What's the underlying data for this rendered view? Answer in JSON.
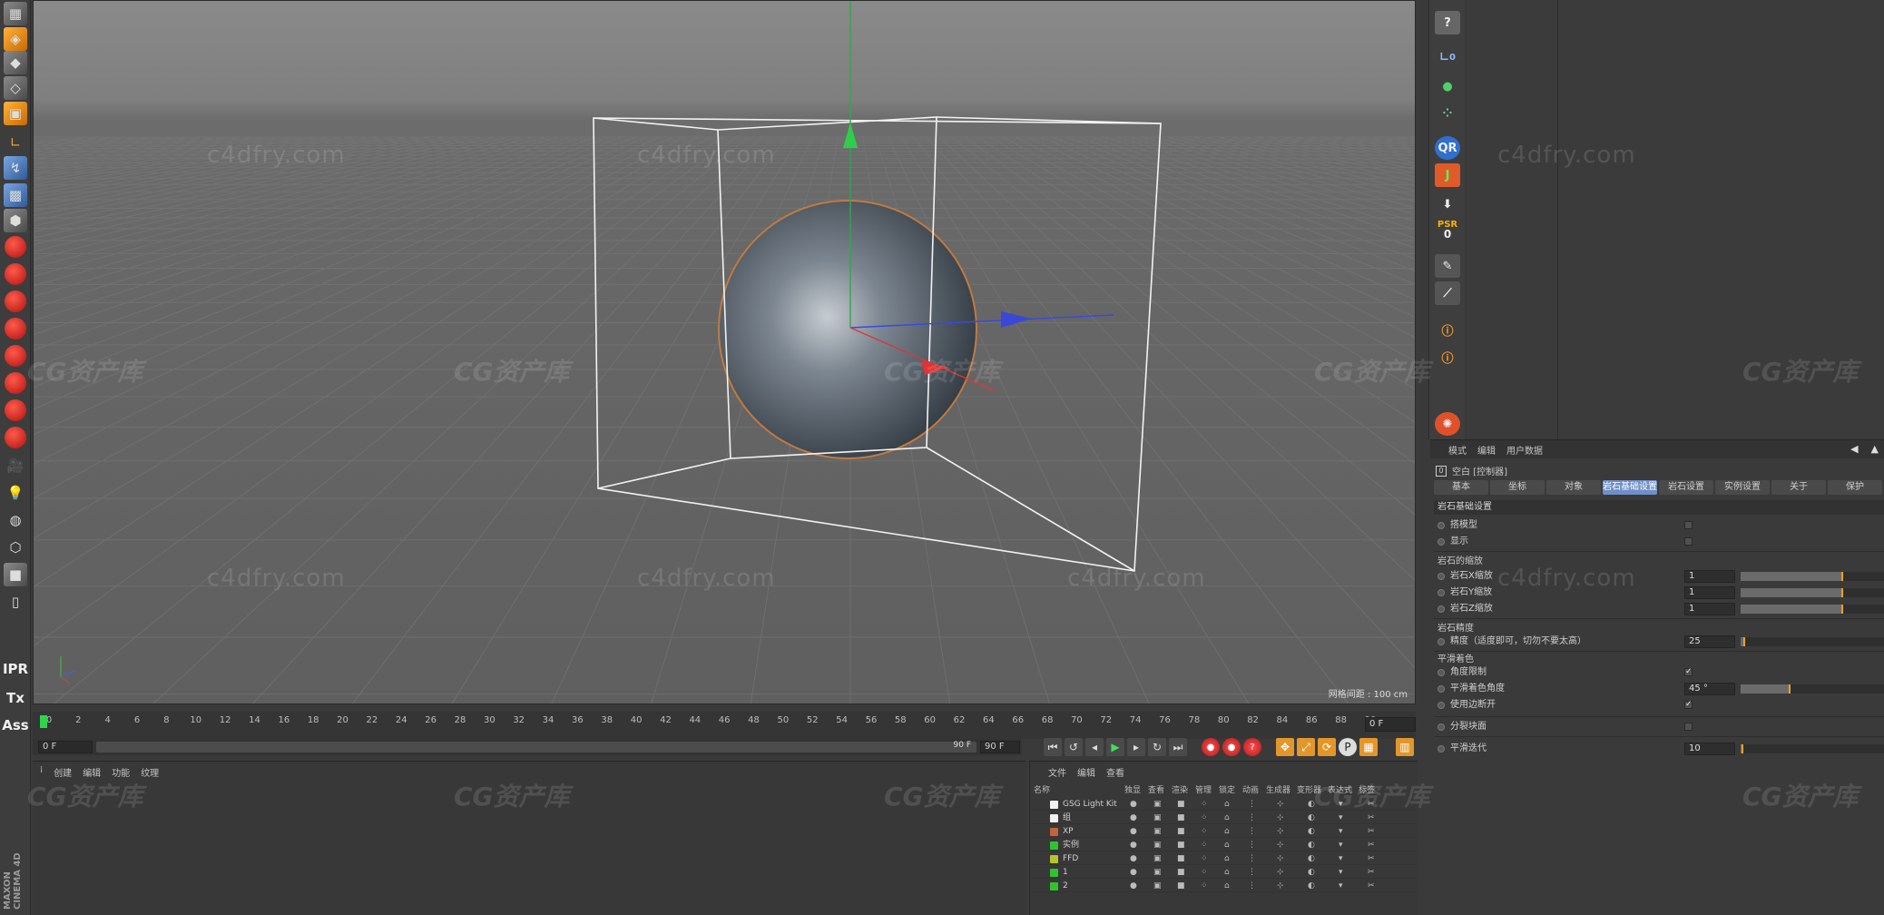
{
  "viewport": {
    "grid_info": "网格间距 : 100 cm"
  },
  "left_tools": [
    "IPR",
    "Tx",
    "Ass"
  ],
  "app_logo": "MAXON CINEMA 4D",
  "right_icons": {
    "psr_label": "PSR",
    "psr_value": "0",
    "qr": "QR",
    "j": "J",
    "l0": "0"
  },
  "attributes": {
    "menu": [
      "模式",
      "编辑",
      "用户数据"
    ],
    "title": "空白 [控制器]",
    "tabs": [
      "基本",
      "坐标",
      "对象",
      "岩石基础设置",
      "岩石设置",
      "实例设置",
      "关于",
      "保护"
    ],
    "active_tab_index": 3,
    "section": "岩石基础设置",
    "rows": {
      "r1": "搭模型",
      "r2": "显示",
      "g1": "岩石的缩放",
      "r3": "岩石X缩放",
      "r3v": "1",
      "r4": "岩石Y缩放",
      "r4v": "1",
      "r5": "岩石Z缩放",
      "r5v": "1",
      "g2": "岩石精度",
      "r6": "精度（适度即可，切勿不要太高）",
      "r6v": "25",
      "g3": "平滑着色",
      "r7": "角度限制",
      "r8": "平滑着色角度",
      "r8v": "45 °",
      "r9": "使用边断开",
      "r10": "分裂块面",
      "r11": "平滑迭代",
      "r11v": "10"
    }
  },
  "timeline": {
    "ticks": [
      "0",
      "2",
      "4",
      "6",
      "8",
      "10",
      "12",
      "14",
      "16",
      "18",
      "20",
      "22",
      "24",
      "26",
      "28",
      "30",
      "32",
      "34",
      "36",
      "38",
      "40",
      "42",
      "44",
      "46",
      "48",
      "50",
      "52",
      "54",
      "56",
      "58",
      "60",
      "62",
      "64",
      "66",
      "68",
      "70",
      "72",
      "74",
      "76",
      "78",
      "80",
      "82",
      "84",
      "86",
      "88",
      "90"
    ],
    "frame_box": "0 F",
    "range_start": "0 F",
    "range_end_inner": "90 F",
    "range_end": "90 F"
  },
  "material_menu": [
    "创建",
    "编辑",
    "功能",
    "纹理"
  ],
  "objects": {
    "menu": [
      "文件",
      "编辑",
      "查看"
    ],
    "headers": [
      "名称",
      "独显",
      "查看",
      "渲染",
      "管理",
      "锁定",
      "动画",
      "生成器",
      "变形器",
      "表达式",
      "标签"
    ],
    "rows": [
      {
        "name": "GSG Light Kit",
        "color": "#f2f2f2"
      },
      {
        "name": "组",
        "color": "#f2f2f2"
      },
      {
        "name": "XP",
        "color": "#c2643a"
      },
      {
        "name": "实例",
        "color": "#2ec42e"
      },
      {
        "name": "FFD",
        "color": "#b6c430"
      },
      {
        "name": "1",
        "color": "#2ec42e"
      },
      {
        "name": "2",
        "color": "#2ec42e"
      }
    ]
  },
  "watermarks": {
    "site": "c4dfry.com",
    "brand": "CG资产库"
  }
}
